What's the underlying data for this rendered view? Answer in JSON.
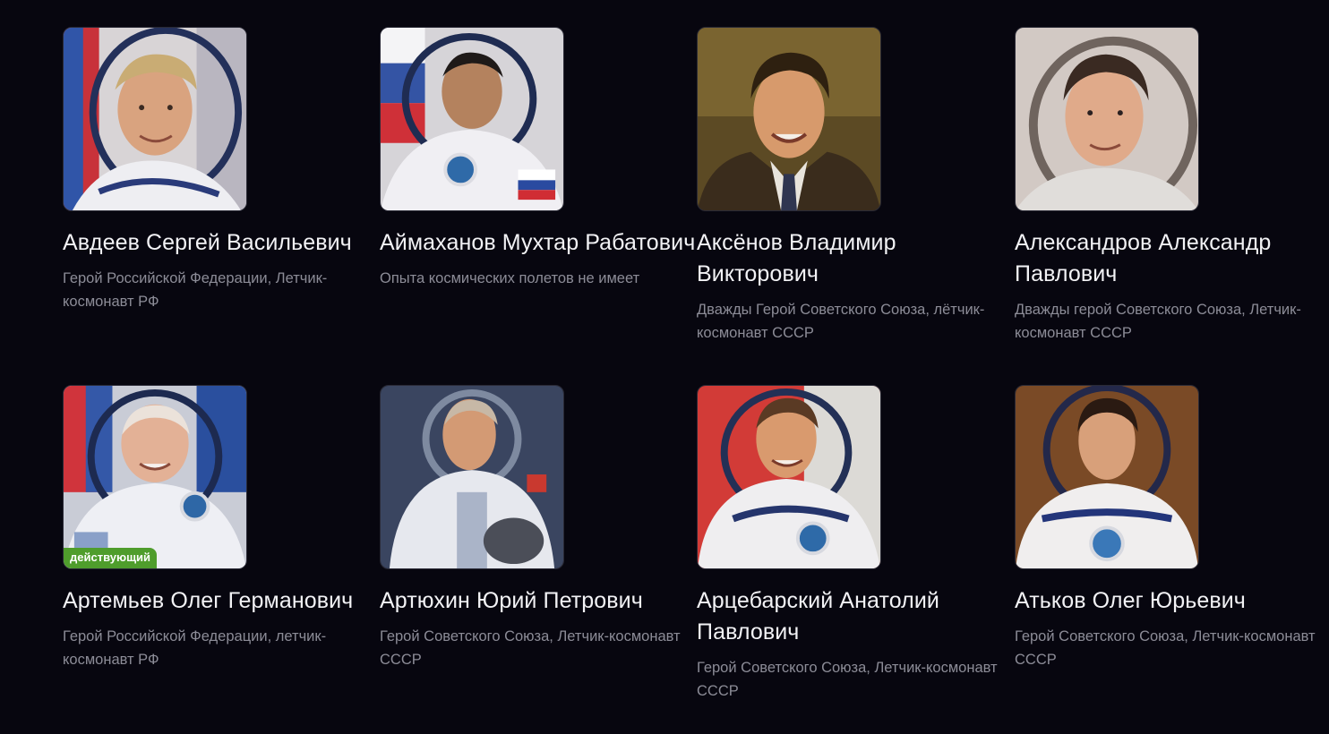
{
  "cosmonauts": [
    {
      "name": "Авдеев Сергей Васильевич",
      "description": "Герой Российской Федерации, Летчик-космонавт РФ",
      "badge": "",
      "photo_icon": "astronaut-portrait-suit-flag"
    },
    {
      "name": "Аймаханов Мухтар Рабатович",
      "description": "Опыта космических полетов не имеет",
      "badge": "",
      "photo_icon": "astronaut-portrait-suit-flag"
    },
    {
      "name": "Аксёнов Владимир Викторович",
      "description": "Дважды Герой Советского Союза, лётчик-космонавт СССР",
      "badge": "",
      "photo_icon": "portrait-business-suit"
    },
    {
      "name": "Александров Александр Павлович",
      "description": "Дважды герой Советского Союза, Летчик-космонавт СССР",
      "badge": "",
      "photo_icon": "astronaut-portrait-suit"
    },
    {
      "name": "Артемьев Олег Германович",
      "description": "Герой Российской Федерации, летчик-космонавт РФ",
      "badge": "действующий",
      "photo_icon": "astronaut-portrait-suit-flag"
    },
    {
      "name": "Артюхин Юрий Петрович",
      "description": "Герой Советского Союза, Летчик-космонавт СССР",
      "badge": "",
      "photo_icon": "astronaut-portrait-suit-helmet"
    },
    {
      "name": "Арцебарский Анатолий Павлович",
      "description": "Герой Советского Союза, Летчик-космонавт СССР",
      "badge": "",
      "photo_icon": "astronaut-portrait-suit-flag"
    },
    {
      "name": "Атьков Олег Юрьевич",
      "description": "Герой Советского Союза, Летчик-космонавт СССР",
      "badge": "",
      "photo_icon": "astronaut-portrait-suit"
    }
  ],
  "colors": {
    "background": "#07060f",
    "name_text": "#f2f2f5",
    "description_text": "#8c8c97",
    "badge_bg": "#4f9d2c"
  }
}
